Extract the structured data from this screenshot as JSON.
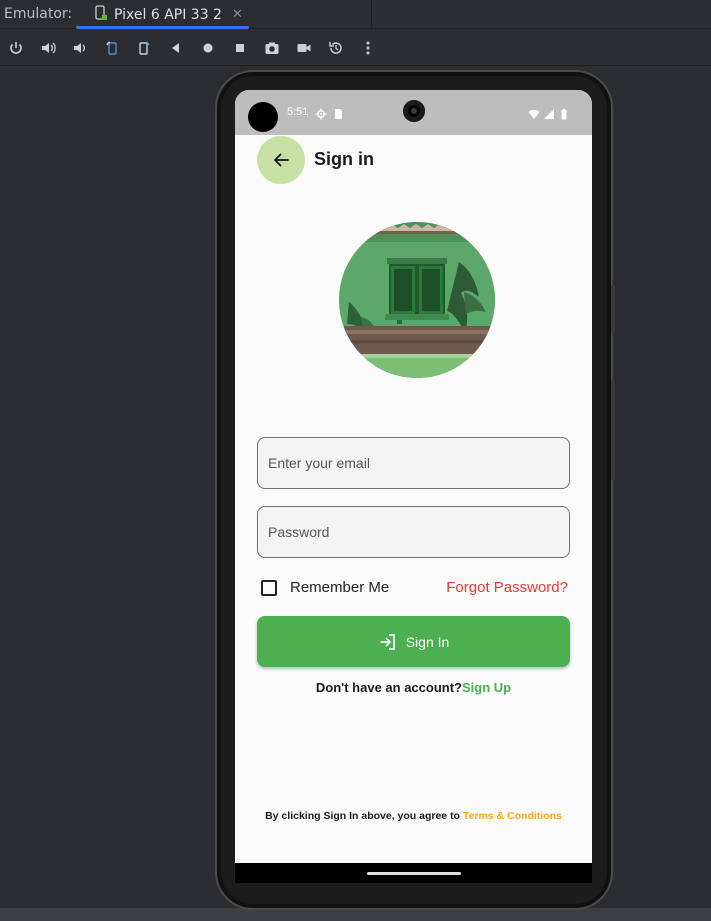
{
  "ide": {
    "emulator_label": "Emulator:",
    "device_tab": "Pixel 6 API 33 2",
    "close_glyph": "✕",
    "toolbar_icons": [
      "power-icon",
      "volume-up-icon",
      "volume-down-icon",
      "rotate-left-icon",
      "rotate-right-icon",
      "back-icon",
      "home-icon",
      "overview-icon",
      "screenshot-icon",
      "screen-record-icon",
      "snapshot-icon",
      "more-icon"
    ],
    "accent": "#3574f0"
  },
  "status_bar": {
    "time": "5:51"
  },
  "app_bar": {
    "title": "Sign in"
  },
  "form": {
    "email_placeholder": "Enter your email",
    "password_placeholder": "Password",
    "remember_label": "Remember Me",
    "forgot_label": "Forgot Password?",
    "signin_label": "Sign In"
  },
  "signup": {
    "question": "Don't have an account?",
    "link": "Sign Up"
  },
  "terms": {
    "text": "By clicking Sign In above, you agree to ",
    "link": "Terms & Conditions"
  },
  "colors": {
    "primary_green": "#4caf50",
    "back_button_bg": "#c5e1a5",
    "forgot_red": "#e53935",
    "terms_orange": "#f5a623"
  }
}
